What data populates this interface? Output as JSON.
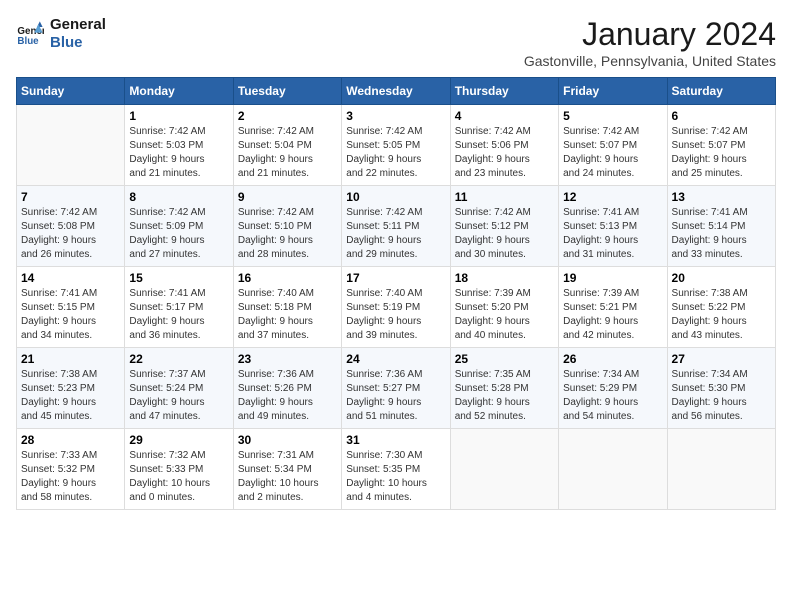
{
  "header": {
    "logo_line1": "General",
    "logo_line2": "Blue",
    "month_title": "January 2024",
    "location": "Gastonville, Pennsylvania, United States"
  },
  "days_of_week": [
    "Sunday",
    "Monday",
    "Tuesday",
    "Wednesday",
    "Thursday",
    "Friday",
    "Saturday"
  ],
  "weeks": [
    [
      {
        "day": "",
        "info": ""
      },
      {
        "day": "1",
        "info": "Sunrise: 7:42 AM\nSunset: 5:03 PM\nDaylight: 9 hours\nand 21 minutes."
      },
      {
        "day": "2",
        "info": "Sunrise: 7:42 AM\nSunset: 5:04 PM\nDaylight: 9 hours\nand 21 minutes."
      },
      {
        "day": "3",
        "info": "Sunrise: 7:42 AM\nSunset: 5:05 PM\nDaylight: 9 hours\nand 22 minutes."
      },
      {
        "day": "4",
        "info": "Sunrise: 7:42 AM\nSunset: 5:06 PM\nDaylight: 9 hours\nand 23 minutes."
      },
      {
        "day": "5",
        "info": "Sunrise: 7:42 AM\nSunset: 5:07 PM\nDaylight: 9 hours\nand 24 minutes."
      },
      {
        "day": "6",
        "info": "Sunrise: 7:42 AM\nSunset: 5:07 PM\nDaylight: 9 hours\nand 25 minutes."
      }
    ],
    [
      {
        "day": "7",
        "info": "Sunrise: 7:42 AM\nSunset: 5:08 PM\nDaylight: 9 hours\nand 26 minutes."
      },
      {
        "day": "8",
        "info": "Sunrise: 7:42 AM\nSunset: 5:09 PM\nDaylight: 9 hours\nand 27 minutes."
      },
      {
        "day": "9",
        "info": "Sunrise: 7:42 AM\nSunset: 5:10 PM\nDaylight: 9 hours\nand 28 minutes."
      },
      {
        "day": "10",
        "info": "Sunrise: 7:42 AM\nSunset: 5:11 PM\nDaylight: 9 hours\nand 29 minutes."
      },
      {
        "day": "11",
        "info": "Sunrise: 7:42 AM\nSunset: 5:12 PM\nDaylight: 9 hours\nand 30 minutes."
      },
      {
        "day": "12",
        "info": "Sunrise: 7:41 AM\nSunset: 5:13 PM\nDaylight: 9 hours\nand 31 minutes."
      },
      {
        "day": "13",
        "info": "Sunrise: 7:41 AM\nSunset: 5:14 PM\nDaylight: 9 hours\nand 33 minutes."
      }
    ],
    [
      {
        "day": "14",
        "info": "Sunrise: 7:41 AM\nSunset: 5:15 PM\nDaylight: 9 hours\nand 34 minutes."
      },
      {
        "day": "15",
        "info": "Sunrise: 7:41 AM\nSunset: 5:17 PM\nDaylight: 9 hours\nand 36 minutes."
      },
      {
        "day": "16",
        "info": "Sunrise: 7:40 AM\nSunset: 5:18 PM\nDaylight: 9 hours\nand 37 minutes."
      },
      {
        "day": "17",
        "info": "Sunrise: 7:40 AM\nSunset: 5:19 PM\nDaylight: 9 hours\nand 39 minutes."
      },
      {
        "day": "18",
        "info": "Sunrise: 7:39 AM\nSunset: 5:20 PM\nDaylight: 9 hours\nand 40 minutes."
      },
      {
        "day": "19",
        "info": "Sunrise: 7:39 AM\nSunset: 5:21 PM\nDaylight: 9 hours\nand 42 minutes."
      },
      {
        "day": "20",
        "info": "Sunrise: 7:38 AM\nSunset: 5:22 PM\nDaylight: 9 hours\nand 43 minutes."
      }
    ],
    [
      {
        "day": "21",
        "info": "Sunrise: 7:38 AM\nSunset: 5:23 PM\nDaylight: 9 hours\nand 45 minutes."
      },
      {
        "day": "22",
        "info": "Sunrise: 7:37 AM\nSunset: 5:24 PM\nDaylight: 9 hours\nand 47 minutes."
      },
      {
        "day": "23",
        "info": "Sunrise: 7:36 AM\nSunset: 5:26 PM\nDaylight: 9 hours\nand 49 minutes."
      },
      {
        "day": "24",
        "info": "Sunrise: 7:36 AM\nSunset: 5:27 PM\nDaylight: 9 hours\nand 51 minutes."
      },
      {
        "day": "25",
        "info": "Sunrise: 7:35 AM\nSunset: 5:28 PM\nDaylight: 9 hours\nand 52 minutes."
      },
      {
        "day": "26",
        "info": "Sunrise: 7:34 AM\nSunset: 5:29 PM\nDaylight: 9 hours\nand 54 minutes."
      },
      {
        "day": "27",
        "info": "Sunrise: 7:34 AM\nSunset: 5:30 PM\nDaylight: 9 hours\nand 56 minutes."
      }
    ],
    [
      {
        "day": "28",
        "info": "Sunrise: 7:33 AM\nSunset: 5:32 PM\nDaylight: 9 hours\nand 58 minutes."
      },
      {
        "day": "29",
        "info": "Sunrise: 7:32 AM\nSunset: 5:33 PM\nDaylight: 10 hours\nand 0 minutes."
      },
      {
        "day": "30",
        "info": "Sunrise: 7:31 AM\nSunset: 5:34 PM\nDaylight: 10 hours\nand 2 minutes."
      },
      {
        "day": "31",
        "info": "Sunrise: 7:30 AM\nSunset: 5:35 PM\nDaylight: 10 hours\nand 4 minutes."
      },
      {
        "day": "",
        "info": ""
      },
      {
        "day": "",
        "info": ""
      },
      {
        "day": "",
        "info": ""
      }
    ]
  ]
}
